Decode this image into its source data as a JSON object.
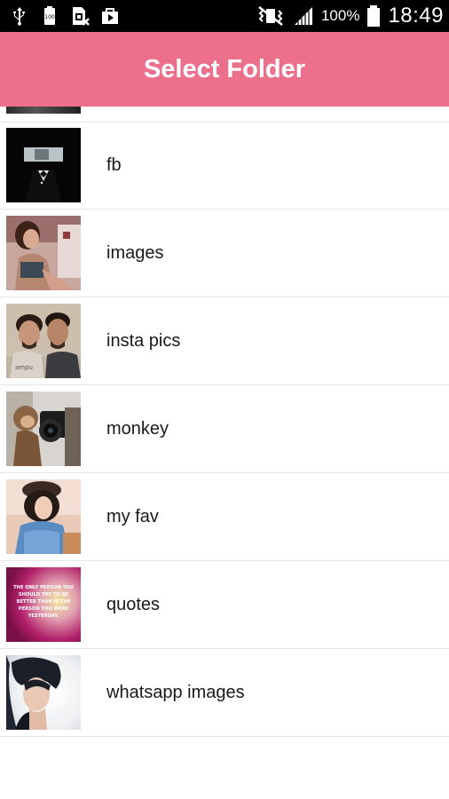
{
  "status_bar": {
    "battery_percent": "100%",
    "time": "18:49",
    "icons": [
      "usb-icon",
      "battery-100-icon",
      "sim-error-icon",
      "play-store-icon",
      "vibrate-mute-icon",
      "signal-icon",
      "battery-icon"
    ]
  },
  "app_bar": {
    "title": "Select Folder",
    "color": "#ec6f8c"
  },
  "folders": [
    {
      "label": "fb"
    },
    {
      "label": "images"
    },
    {
      "label": "insta pics"
    },
    {
      "label": "monkey"
    },
    {
      "label": "my fav"
    },
    {
      "label": "quotes"
    },
    {
      "label": "whatsapp images"
    }
  ],
  "quote_thumbnail_text": "THE ONLY PERSON YOU SHOULD TRY TO BE BETTER THAN IS THE PERSON YOU WERE YESTERDAY."
}
